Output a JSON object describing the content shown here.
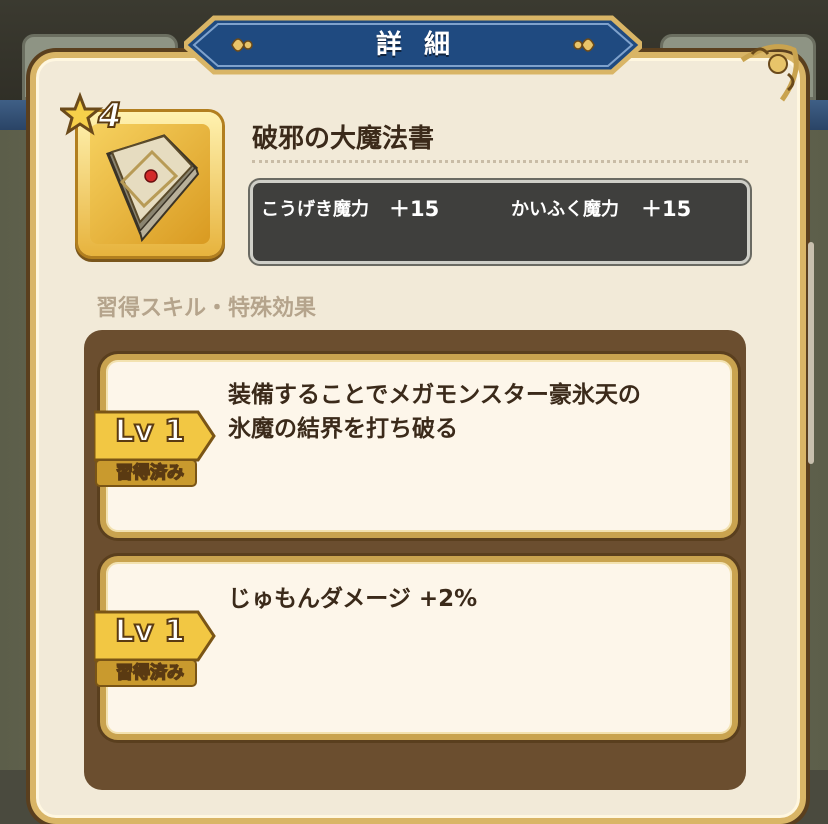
{
  "header": {
    "title": "詳細"
  },
  "item": {
    "name": "破邪の大魔法書",
    "rarity": "4",
    "icon": "spellbook-icon",
    "stats": [
      {
        "label": "こうげき魔力",
        "value": "＋15"
      },
      {
        "label": "かいふく魔力",
        "value": "＋15"
      }
    ]
  },
  "section": {
    "label": "習得スキル・特殊効果"
  },
  "skills": [
    {
      "description_line1": "装備することでメガモンスター豪氷天の",
      "description_line2": "氷魔の結界を打ち破る",
      "level": "Lv 1",
      "status": "習得済み"
    },
    {
      "description_line1": "じゅもんダメージ +2%",
      "level": "Lv 1",
      "status": "習得済み"
    }
  ],
  "colors": {
    "frame_gold": "#d9b566",
    "panel_bg": "#f2ead8",
    "stats_bg": "#3f3f3d",
    "ribbon_blue": "#1f4a80"
  }
}
